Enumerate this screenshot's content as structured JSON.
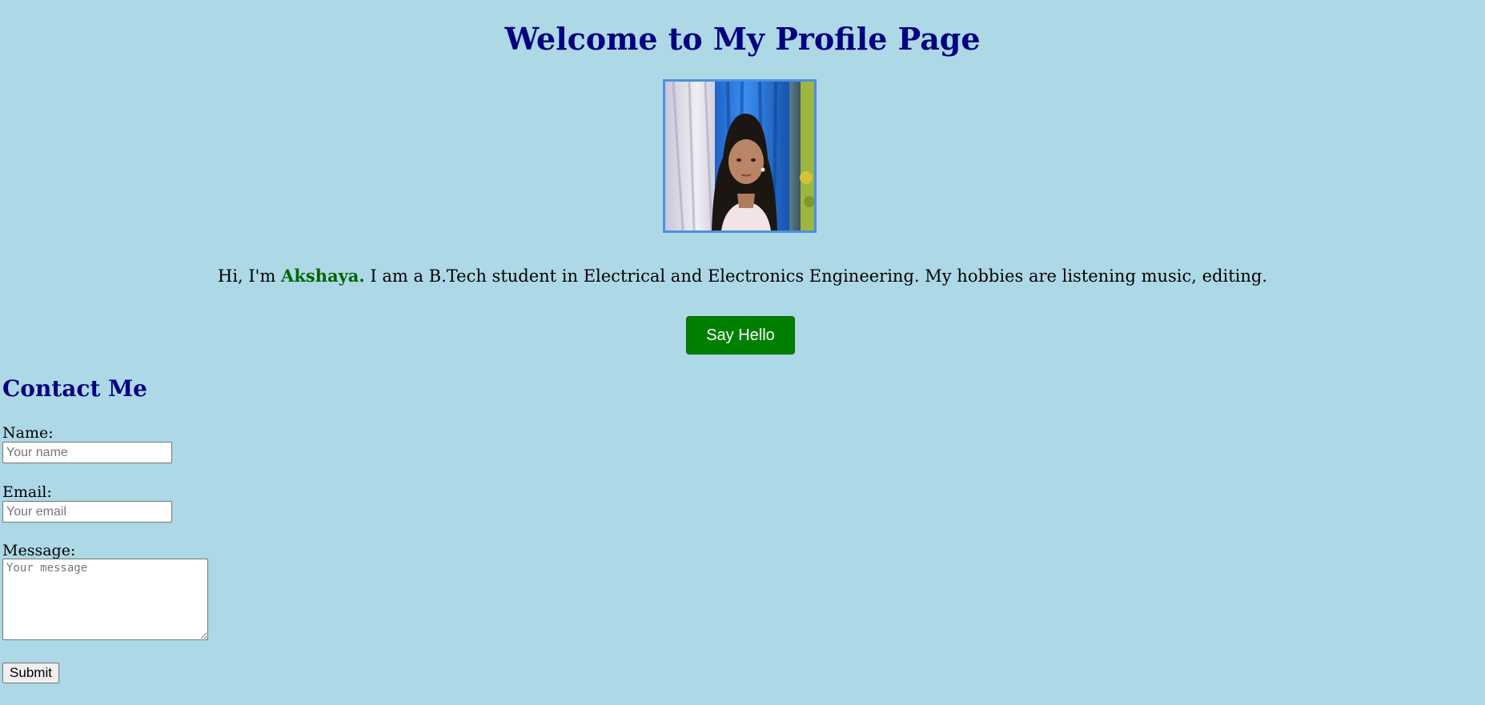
{
  "header": {
    "title": "Welcome to My Profile Page"
  },
  "profile": {
    "intro_prefix": "Hi, I'm ",
    "name": "Akshaya.",
    "intro_suffix": " I am a B.Tech student in Electrical and Electronics Engineering. My hobbies are listening music, editing.",
    "hello_button_label": "Say Hello",
    "accent_name_color": "#006400",
    "avatar_icon": "profile-photo"
  },
  "contact": {
    "title": "Contact Me",
    "name_label": "Name:",
    "name_placeholder": "Your name",
    "email_label": "Email:",
    "email_placeholder": "Your email",
    "message_label": "Message:",
    "message_placeholder": "Your message",
    "submit_label": "Submit"
  },
  "colors": {
    "background": "#add8e6",
    "heading": "#000080",
    "button": "#008000"
  }
}
